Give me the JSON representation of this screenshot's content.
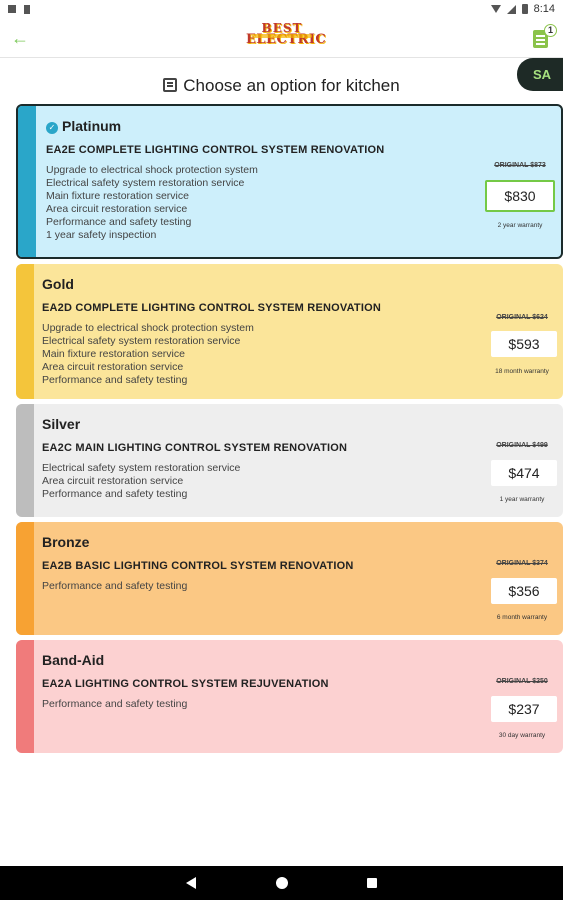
{
  "status_bar": {
    "time": "8:14"
  },
  "app_bar": {
    "logo_line1": "BEST",
    "logo_line2": "ELECTRIC",
    "cart_count": "1"
  },
  "heading": {
    "text": "Choose an option for kitchen"
  },
  "user": {
    "initials": "SA"
  },
  "options": [
    {
      "tier": "Platinum",
      "package": "EA2E COMPLETE LIGHTING CONTROL SYSTEM RENOVATION",
      "features": [
        "Upgrade to electrical shock protection system",
        "Electrical safety system restoration service",
        "Main fixture restoration service",
        "Area circuit restoration service",
        "Performance and safety testing",
        "1 year safety inspection"
      ],
      "original": "ORIGINAL $873",
      "price": "$830",
      "warranty": "2 year warranty",
      "selected": true
    },
    {
      "tier": "Gold",
      "package": "EA2D COMPLETE LIGHTING CONTROL SYSTEM RENOVATION",
      "features": [
        "Upgrade to electrical shock protection system",
        "Electrical safety system restoration service",
        "Main fixture restoration service",
        "Area circuit restoration service",
        "Performance and safety testing"
      ],
      "original": "ORIGINAL $624",
      "price": "$593",
      "warranty": "18 month warranty"
    },
    {
      "tier": "Silver",
      "package": "EA2C MAIN LIGHTING CONTROL SYSTEM RENOVATION",
      "features": [
        "Electrical safety system restoration service",
        "Area circuit restoration service",
        "Performance and safety testing"
      ],
      "original": "ORIGINAL $499",
      "price": "$474",
      "warranty": "1 year warranty"
    },
    {
      "tier": "Bronze",
      "package": "EA2B BASIC LIGHTING CONTROL SYSTEM RENOVATION",
      "features": [
        "Performance and safety testing"
      ],
      "original": "ORIGINAL $374",
      "price": "$356",
      "warranty": "6 month warranty"
    },
    {
      "tier": "Band-Aid",
      "package": "EA2A LIGHTING CONTROL SYSTEM REJUVENATION",
      "features": [
        "Performance and safety testing"
      ],
      "original": "ORIGINAL $250",
      "price": "$237",
      "warranty": "30 day warranty"
    }
  ],
  "colors": {
    "platinum_bg": "#cdeffb",
    "gold_bg": "#fbe59a",
    "silver_bg": "#eeeeee",
    "bronze_bg": "#fbc884",
    "bandaid_bg": "#fcd1d1",
    "accent_green": "#74c946"
  }
}
